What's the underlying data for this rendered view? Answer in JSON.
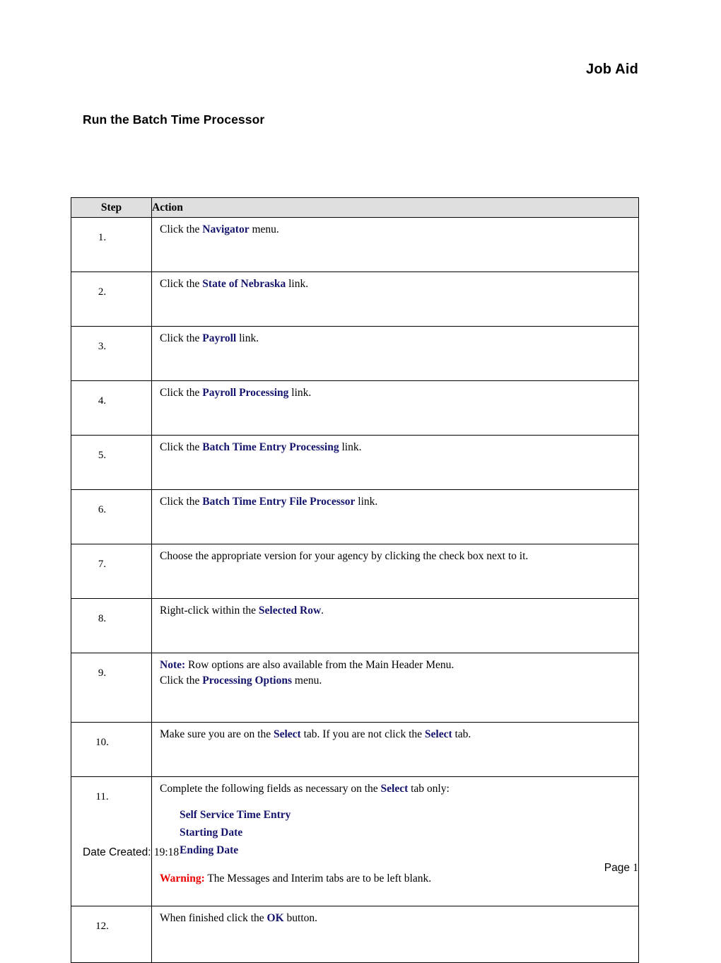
{
  "header": {
    "doc_kind": "Job Aid",
    "title": "Run the Batch Time Processor"
  },
  "table": {
    "columns": {
      "step": "Step",
      "action": "Action"
    },
    "rows": [
      {
        "step": "1.",
        "prefix": "Click the ",
        "bold": "Navigator",
        "suffix": " menu."
      },
      {
        "step": "2.",
        "prefix": "Click the ",
        "bold": "State of Nebraska",
        "suffix": " link."
      },
      {
        "step": "3.",
        "prefix": "Click the ",
        "bold": "Payroll",
        "suffix": " link."
      },
      {
        "step": "4.",
        "prefix": "Click the ",
        "bold": "Payroll Processing",
        "suffix": " link."
      },
      {
        "step": "5.",
        "prefix": "Click the ",
        "bold": "Batch Time Entry Processing",
        "suffix": " link."
      },
      {
        "step": "6.",
        "prefix": "Click the ",
        "bold": "Batch Time Entry File Processor",
        "suffix": " link."
      },
      {
        "step": "7.",
        "prefix": "Choose the appropriate version for your agency by clicking the check box next to it.",
        "bold": "",
        "suffix": ""
      },
      {
        "step": "8.",
        "prefix": "Right-click within the ",
        "bold": "Selected Row",
        "suffix": "."
      },
      {
        "step": "9.",
        "note_label": "Note:",
        "note_text": "  Row options are also available from the Main Header Menu.",
        "prefix": "Click the ",
        "bold": "Processing Options",
        "suffix": " menu."
      },
      {
        "step": "10.",
        "prefix": "Make sure you are on the ",
        "bold": "Select",
        "mid": " tab.  If you are not click the ",
        "bold2": "Select",
        "suffix": " tab."
      },
      {
        "step": "11.",
        "prefix": "Complete the following fields as necessary on the ",
        "bold": "Select",
        "suffix": " tab only:",
        "fields": [
          "Self Service Time Entry",
          "Starting Date",
          "Ending Date"
        ],
        "warning_label": "Warning:",
        "warning_text": " The Messages and Interim tabs are to be left blank."
      },
      {
        "step": "12.",
        "prefix": "When finished click the ",
        "bold": "OK",
        "suffix": " button."
      }
    ]
  },
  "footer": {
    "date_label": "Date Created: ",
    "date_value": "19:18",
    "page_label": "Page ",
    "page_value": "1"
  },
  "colors": {
    "bold_blue": "#15156e",
    "warning_red": "#ee0000",
    "header_fill": "#dfdfdf",
    "border": "#000000"
  }
}
